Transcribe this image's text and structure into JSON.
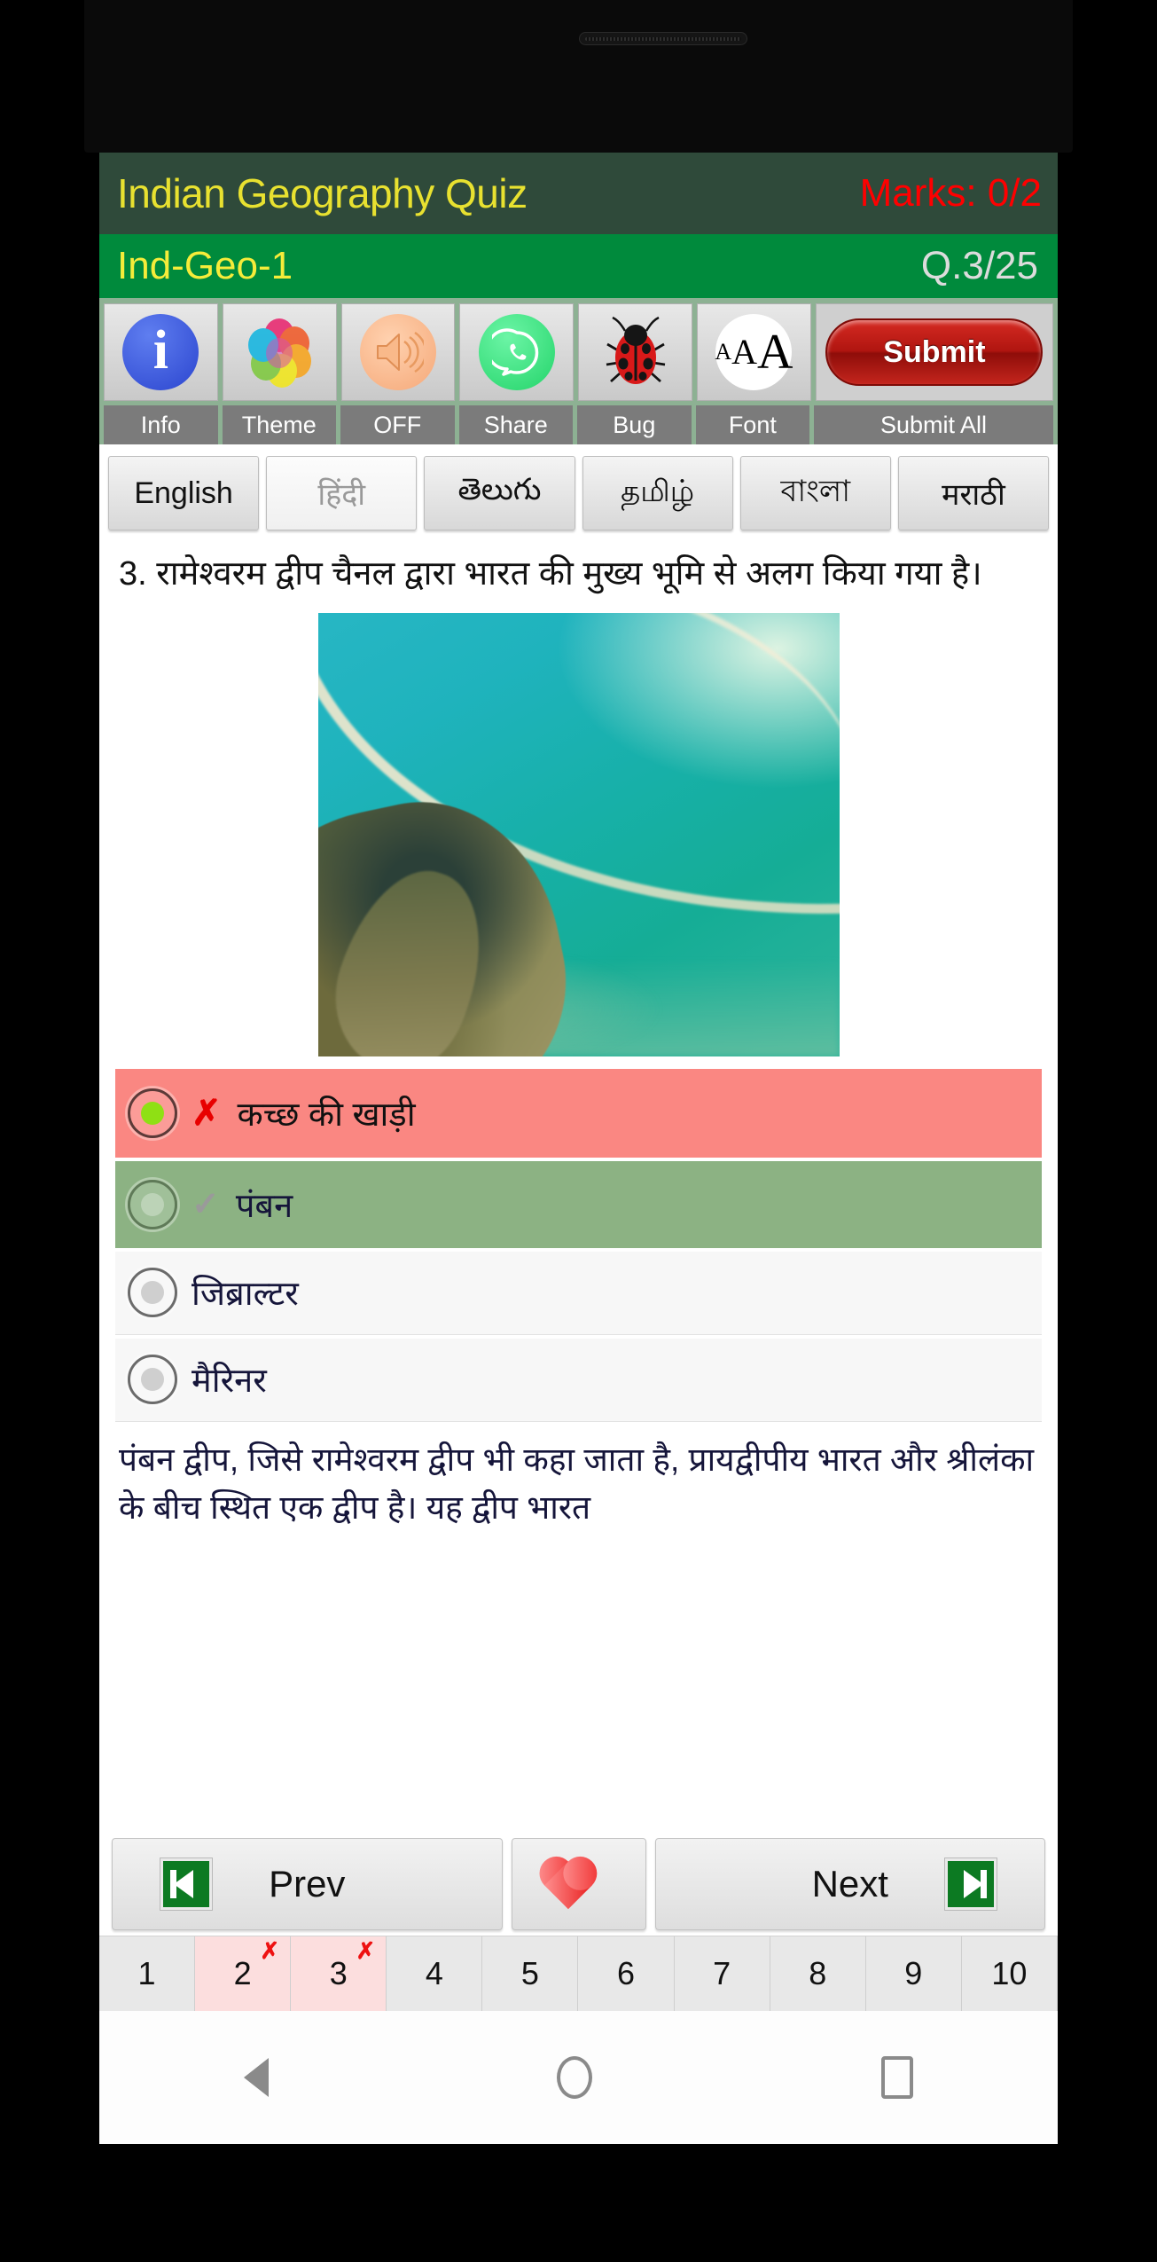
{
  "header": {
    "app_title": "Indian Geography Quiz",
    "marks": "Marks: 0/2",
    "quiz_code": "Ind-Geo-1",
    "question_counter": "Q.3/25",
    "title_bg": "#2f4a3a",
    "title_color": "#e8e130",
    "marks_color": "#ff0000",
    "subtitle_bg": "#008a3c",
    "quiz_code_color": "#f5ec3a",
    "counter_color": "#dcdcdc"
  },
  "toolbar": {
    "items": [
      {
        "icon": "info-icon",
        "label": "Info"
      },
      {
        "icon": "color-wheel-icon",
        "label": "Theme"
      },
      {
        "icon": "speaker-icon",
        "label": "OFF"
      },
      {
        "icon": "whatsapp-icon",
        "label": "Share"
      },
      {
        "icon": "ladybug-icon",
        "label": "Bug"
      },
      {
        "icon": "font-size-icon",
        "label": "Font"
      }
    ],
    "submit_button": "Submit",
    "submit_label": "Submit All",
    "submit_color": "#b01510"
  },
  "languages": [
    {
      "label": "English",
      "selected": false
    },
    {
      "label": "हिंदी",
      "selected": true
    },
    {
      "label": "తెలుగు",
      "selected": false
    },
    {
      "label": "தமிழ்",
      "selected": false
    },
    {
      "label": "বাংলা",
      "selected": false
    },
    {
      "label": "मराठी",
      "selected": false
    }
  ],
  "question": {
    "text": "3. रामेश्वरम द्वीप चैनल द्वारा भारत की मुख्य भूमि से अलग किया गया है।",
    "image_alt": "aerial-view-of-pamban-island-sandbar"
  },
  "options": [
    {
      "label": "कच्छ की खाड़ी",
      "state": "wrong",
      "mark": "✗",
      "selected": true
    },
    {
      "label": "पंबन",
      "state": "correct",
      "mark": "✓",
      "selected": false
    },
    {
      "label": "जिब्राल्टर",
      "state": "plain",
      "mark": "",
      "selected": false
    },
    {
      "label": "मैरिनर",
      "state": "plain",
      "mark": "",
      "selected": false
    }
  ],
  "explanation": "पंबन द्वीप, जिसे रामेश्वरम द्वीप भी कहा जाता है, प्रायद्वीपीय भारत और श्रीलंका के बीच स्थित एक द्वीप है। यह द्वीप भारत",
  "nav": {
    "prev": "Prev",
    "next": "Next",
    "favorite_icon": "heart-icon"
  },
  "pagination": [
    {
      "num": "1",
      "marked": false,
      "x": ""
    },
    {
      "num": "2",
      "marked": true,
      "x": "✗"
    },
    {
      "num": "3",
      "marked": true,
      "x": "✗"
    },
    {
      "num": "4",
      "marked": false,
      "x": ""
    },
    {
      "num": "5",
      "marked": false,
      "x": ""
    },
    {
      "num": "6",
      "marked": false,
      "x": ""
    },
    {
      "num": "7",
      "marked": false,
      "x": ""
    },
    {
      "num": "8",
      "marked": false,
      "x": ""
    },
    {
      "num": "9",
      "marked": false,
      "x": ""
    },
    {
      "num": "10",
      "marked": false,
      "x": ""
    }
  ],
  "android_nav": [
    "back-icon",
    "home-icon",
    "recents-icon"
  ]
}
